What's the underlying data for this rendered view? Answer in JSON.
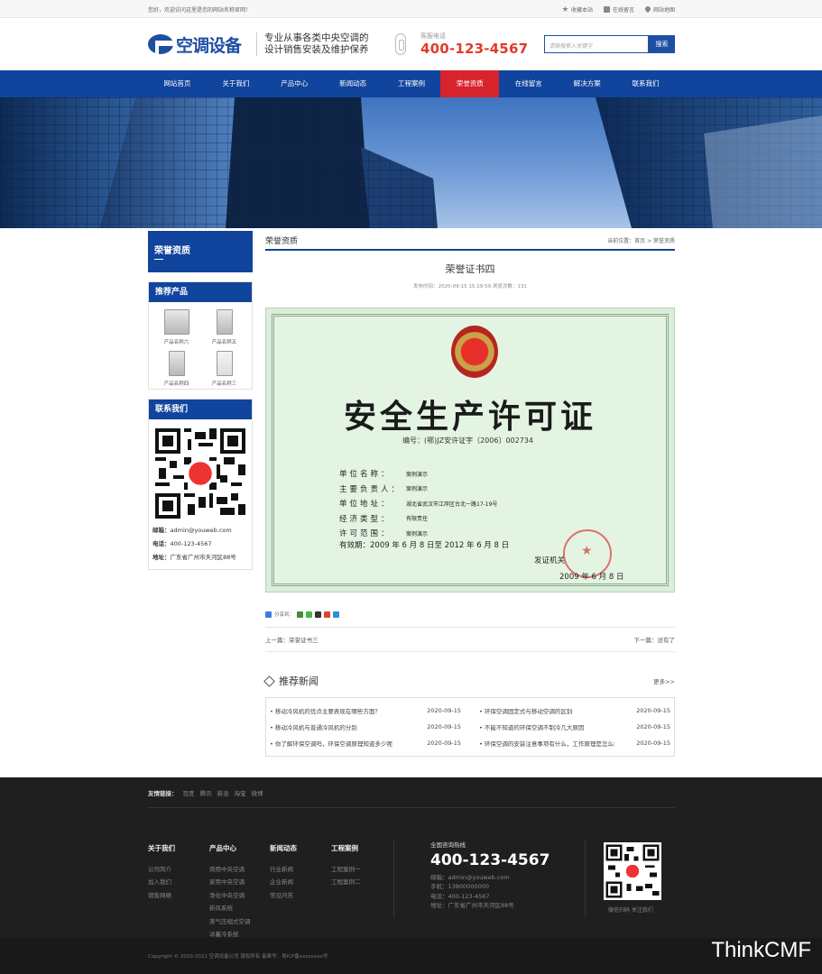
{
  "topbar": {
    "welcome": "您好，欢迎访问这里是您的网站名称官网！",
    "links": [
      {
        "icon": "star-icon",
        "label": "收藏本站"
      },
      {
        "icon": "book-icon",
        "label": "在线留言"
      },
      {
        "icon": "pin-icon",
        "label": "网站地图"
      }
    ]
  },
  "header": {
    "logo_text": "空调设备",
    "slogan_line1": "专业从事各类中央空调的",
    "slogan_line2": "设计销售安装及维护保养",
    "hotline_label": "客服电话",
    "hotline": "400-123-4567",
    "search_placeholder": "请输搜索入关键字",
    "search_button": "搜索"
  },
  "nav": {
    "items": [
      "网站首页",
      "关于我们",
      "产品中心",
      "新闻动态",
      "工程案例",
      "荣誉资质",
      "在线留言",
      "解决方案",
      "联系我们"
    ],
    "active": "荣誉资质",
    "active_color": "#d7232b",
    "bar_color": "#11449d"
  },
  "sidebar": {
    "title": "荣誉资质",
    "products_title": "推荐产品",
    "products": [
      "产品名称六",
      "产品名称五",
      "产品名称四",
      "产品名称三"
    ],
    "contact_title": "联系我们",
    "email_label": "邮箱：",
    "email": "admin@youweb.com",
    "phone_label": "电话：",
    "phone": "400-123-4567",
    "address_label": "地址：",
    "address": "广东省广州市天河区88号"
  },
  "content": {
    "section": "荣誉资质",
    "crumb": "当前位置：首页 > 荣誉资质",
    "title": "荣誉证书四",
    "meta": "发布时间：2020-09-15 15:19:59    浏览次数：131",
    "cert": {
      "heading": "安全生产许可证",
      "number": "编号：(鄂)JZ安许证字〔2006〕002734",
      "rows": [
        {
          "k": "单位名称：",
          "v": "案例演示"
        },
        {
          "k": "主要负责人：",
          "v": "案例演示"
        },
        {
          "k": "单位地址：",
          "v": "湖北省武汉市江岸区台北一路17-19号"
        },
        {
          "k": "经济类型：",
          "v": "有限责任"
        },
        {
          "k": "许可范围：",
          "v": "案例演示"
        }
      ],
      "validity": "有效期：2009 年 6 月 8 日至 2012 年 6 月 8 日",
      "issuer": "发证机关",
      "issue_date": "2009 年 6 月 8 日"
    },
    "share_label": "分享到：",
    "prev": "上一篇：荣誉证书三",
    "next": "下一篇：没有了",
    "rec_title": "推荐新闻",
    "rec_more": "更多>>",
    "news": [
      {
        "t": "移动冷风机的优点主要表现在哪些方面？",
        "d": "2020-09-15"
      },
      {
        "t": "环保空调固定式与移动空调的区别",
        "d": "2020-09-15"
      },
      {
        "t": "移动冷风机与普通冷风机的分别",
        "d": "2020-09-15"
      },
      {
        "t": "不能不知道的环保空调不制冷几大原因",
        "d": "2020-09-15"
      },
      {
        "t": "你了解环保空调吗，环保空调原理知道多少呢",
        "d": "2020-09-15"
      },
      {
        "t": "环保空调的安装注意事项有什么，工作原理是怎么样",
        "d": "2020-09-15"
      }
    ]
  },
  "footer": {
    "friend_label": "友情链接：",
    "friends": [
      "百度",
      "腾讯",
      "新浪",
      "淘宝",
      "微博"
    ],
    "cols": [
      {
        "h": "关于我们",
        "items": [
          "公司简介",
          "加入我们",
          "销售网络"
        ]
      },
      {
        "h": "产品中心",
        "items": [
          "商用中央空调",
          "家用中央空调",
          "净化中央空调",
          "新风系统",
          "蒸气压缩式空调",
          "冰蓄冷系统"
        ]
      },
      {
        "h": "新闻动态",
        "items": [
          "行业新闻",
          "企业新闻",
          "常见问答"
        ]
      },
      {
        "h": "工程案例",
        "items": [
          "工程案例一",
          "工程案例二"
        ]
      }
    ],
    "hot_label": "全国咨询热线",
    "hotline": "400-123-4567",
    "email": "邮箱：admin@youweb.com",
    "mobile": "手机：13800000000",
    "phone": "电话：400-123-4567",
    "address": "地址：广东省广州市天河区88号",
    "qr_label": "微信扫码 关注我们",
    "copyright": "Copyright © 2020-2021 空调设备公司 版权所有   备案号：粤ICP备xxxxxxxx号"
  },
  "watermark": "ThinkCMF"
}
